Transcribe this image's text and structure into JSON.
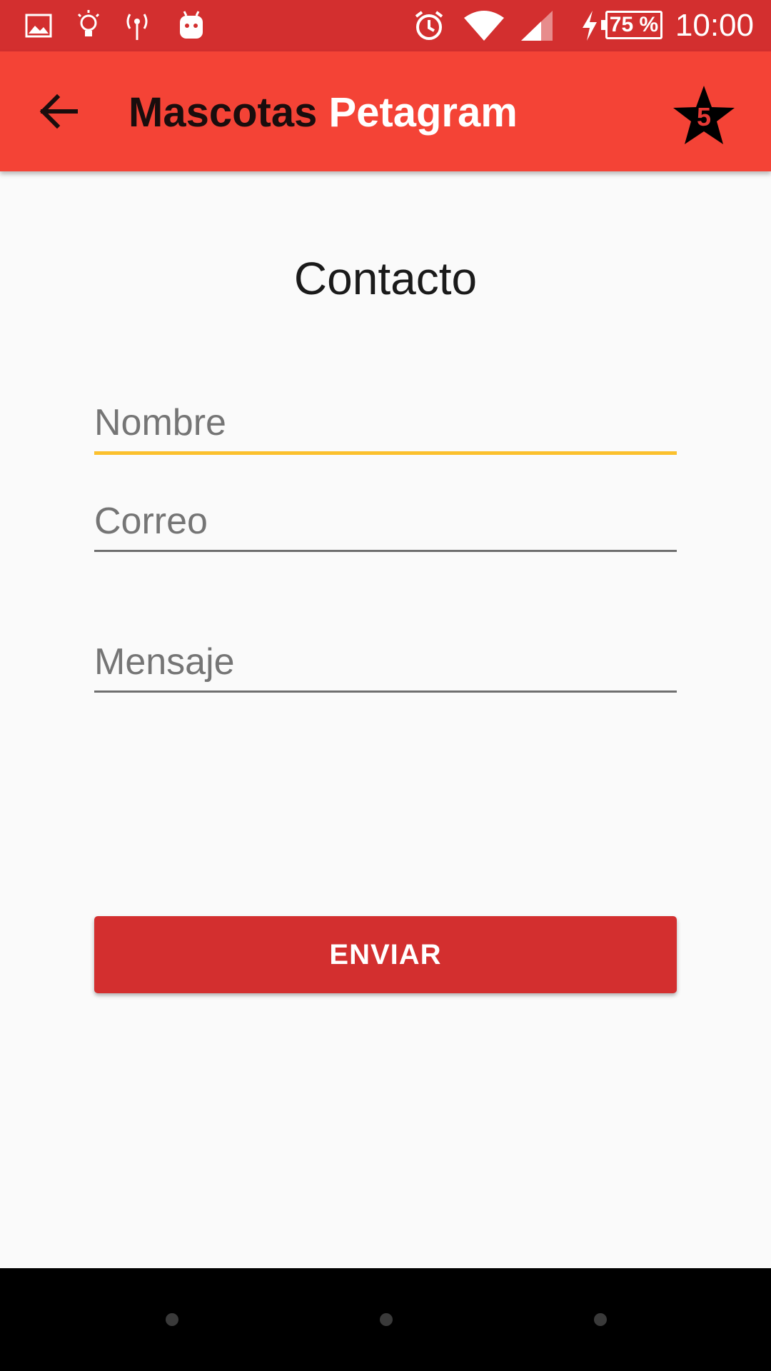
{
  "status_bar": {
    "time": "10:00",
    "battery": "75 %",
    "left_icons": [
      "image-icon",
      "lightbulb-icon",
      "hotspot-icon",
      "android-icon"
    ],
    "right_icons": [
      "alarm-icon",
      "wifi-icon",
      "signal-icon",
      "charging-icon",
      "battery-icon"
    ]
  },
  "app_bar": {
    "title_part1": "Mascotas",
    "title_part2": "Petagram",
    "back_icon": "arrow-back-icon",
    "favorites_count": "5",
    "favorites_icon": "star-icon"
  },
  "form": {
    "heading": "Contacto",
    "name_placeholder": "Nombre",
    "email_placeholder": "Correo",
    "message_placeholder": "Mensaje",
    "submit_label": "ENVIAR"
  },
  "colors": {
    "status_bar": "#d32f2f",
    "app_bar": "#f44336",
    "accent": "#fbc02d",
    "button": "#d32f2f"
  }
}
